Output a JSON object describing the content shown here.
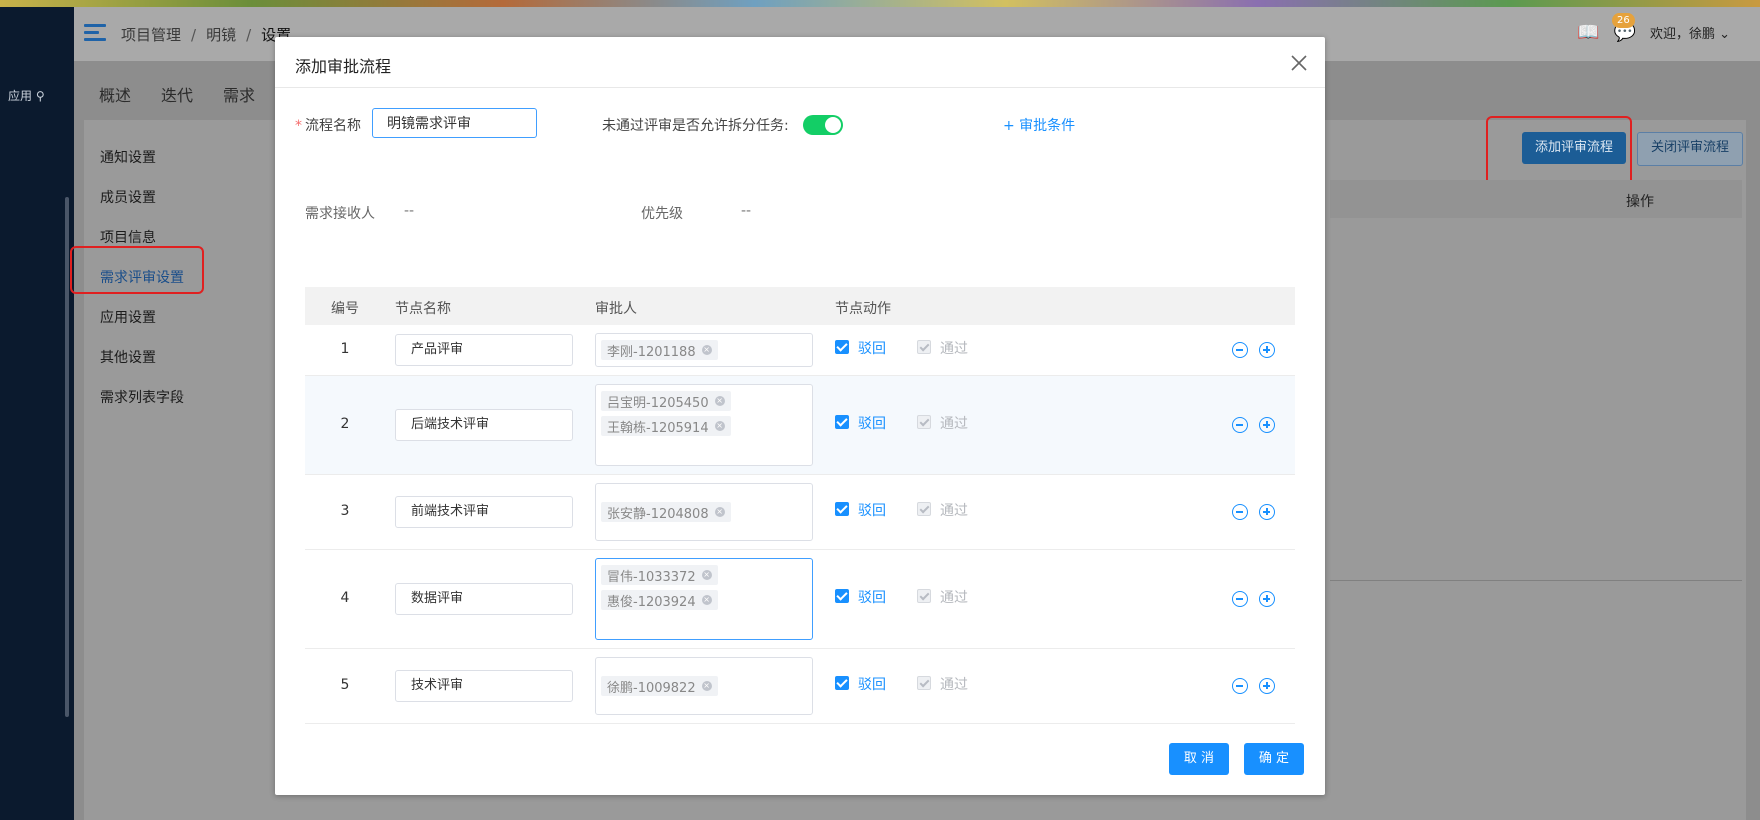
{
  "app": {
    "search_label": "应用",
    "breadcrumb": [
      "项目管理",
      "明镜",
      "设置"
    ],
    "welcome": "欢迎，徐鹏",
    "notification_count": "26",
    "tabs": [
      "概述",
      "迭代",
      "需求"
    ],
    "settings_menu": [
      "通知设置",
      "成员设置",
      "项目信息",
      "需求评审设置",
      "应用设置",
      "其他设置",
      "需求列表字段"
    ],
    "active_menu": "需求评审设置",
    "add_flow_button": "添加评审流程",
    "close_flow_button": "关闭评审流程",
    "table_op_header": "操作"
  },
  "modal": {
    "title": "添加审批流程",
    "flow_name_label": "流程名称",
    "flow_name_value": "明镜需求评审",
    "allow_split_label": "未通过评审是否允许拆分任务:",
    "allow_split_on": true,
    "add_condition": "+ 审批条件",
    "receiver_label": "需求接收人",
    "receiver_value": "--",
    "priority_label": "优先级",
    "priority_value": "--",
    "table": {
      "headers": [
        "编号",
        "节点名称",
        "审批人",
        "节点动作"
      ],
      "rows": [
        {
          "num": "1",
          "node": "产品评审",
          "approvers": [
            "李刚-1201188"
          ],
          "reject": "驳回",
          "pass": "通过"
        },
        {
          "num": "2",
          "node": "后端技术评审",
          "approvers": [
            "吕宝明-1205450",
            "王翰栋-1205914"
          ],
          "reject": "驳回",
          "pass": "通过"
        },
        {
          "num": "3",
          "node": "前端技术评审",
          "approvers": [
            "张安静-1204808"
          ],
          "reject": "驳回",
          "pass": "通过"
        },
        {
          "num": "4",
          "node": "数据评审",
          "approvers": [
            "冒伟-1033372",
            "惠俊-1203924"
          ],
          "reject": "驳回",
          "pass": "通过"
        },
        {
          "num": "5",
          "node": "技术评审",
          "approvers": [
            "徐鹏-1009822"
          ],
          "reject": "驳回",
          "pass": "通过"
        }
      ]
    },
    "cancel_button": "取 消",
    "ok_button": "确 定"
  },
  "colors": {
    "primary": "#1890ff",
    "switch_on": "#13ce66",
    "highlight_box": "#e02020",
    "nav_dark": "#0b1a2e"
  }
}
